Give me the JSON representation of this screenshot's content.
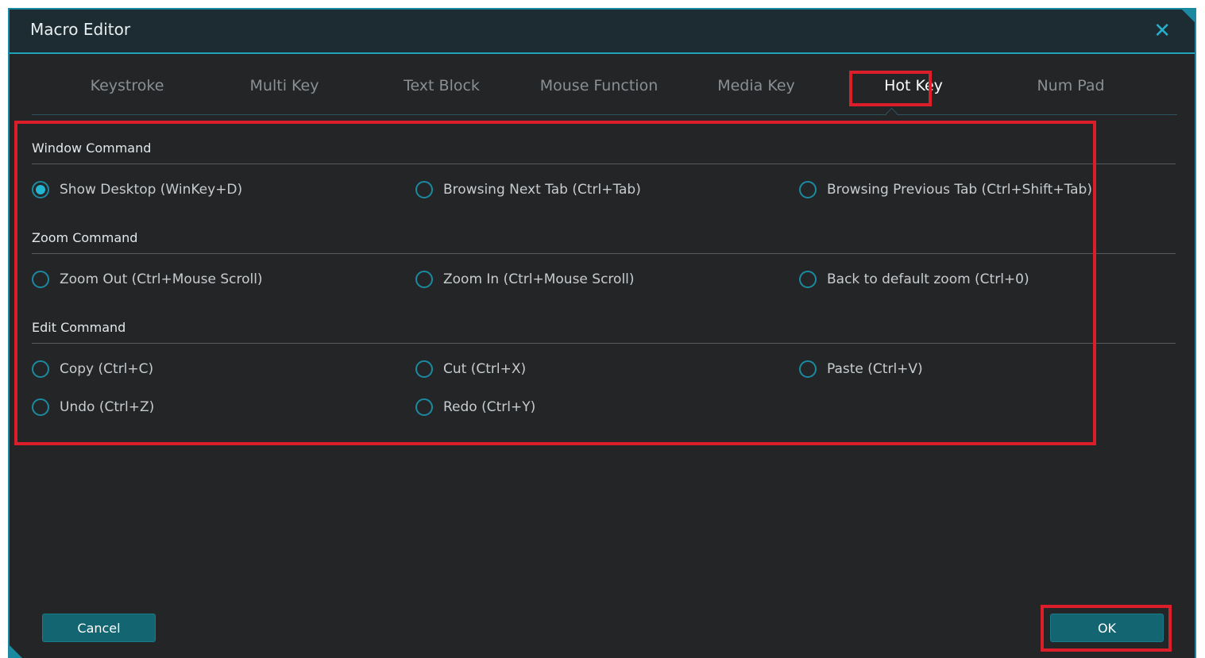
{
  "window": {
    "title": "Macro Editor",
    "close_icon": "close-icon"
  },
  "tabs": [
    {
      "label": "Keystroke",
      "active": false
    },
    {
      "label": "Multi Key",
      "active": false
    },
    {
      "label": "Text Block",
      "active": false
    },
    {
      "label": "Mouse Function",
      "active": false
    },
    {
      "label": "Media Key",
      "active": false
    },
    {
      "label": "Hot Key",
      "active": true
    },
    {
      "label": "Num Pad",
      "active": false
    }
  ],
  "sections": [
    {
      "title": "Window Command",
      "options": [
        {
          "label": "Show Desktop (WinKey+D)",
          "checked": true
        },
        {
          "label": "Browsing Next Tab (Ctrl+Tab)",
          "checked": false
        },
        {
          "label": "Browsing Previous Tab (Ctrl+Shift+Tab)",
          "checked": false
        }
      ]
    },
    {
      "title": "Zoom Command",
      "options": [
        {
          "label": "Zoom Out (Ctrl+Mouse Scroll)",
          "checked": false
        },
        {
          "label": "Zoom In (Ctrl+Mouse Scroll)",
          "checked": false
        },
        {
          "label": "Back to default zoom (Ctrl+0)",
          "checked": false
        }
      ]
    },
    {
      "title": "Edit Command",
      "options": [
        {
          "label": "Copy (Ctrl+C)",
          "checked": false
        },
        {
          "label": "Cut (Ctrl+X)",
          "checked": false
        },
        {
          "label": "Paste (Ctrl+V)",
          "checked": false
        },
        {
          "label": "Undo (Ctrl+Z)",
          "checked": false
        },
        {
          "label": "Redo (Ctrl+Y)",
          "checked": false
        }
      ]
    }
  ],
  "footer": {
    "cancel_label": "Cancel",
    "ok_label": "OK"
  },
  "colors": {
    "accent": "#1b8aa0",
    "radio_fill": "#23b5d2",
    "highlight": "#dc1d2a",
    "background": "#232527",
    "button": "#136571"
  }
}
